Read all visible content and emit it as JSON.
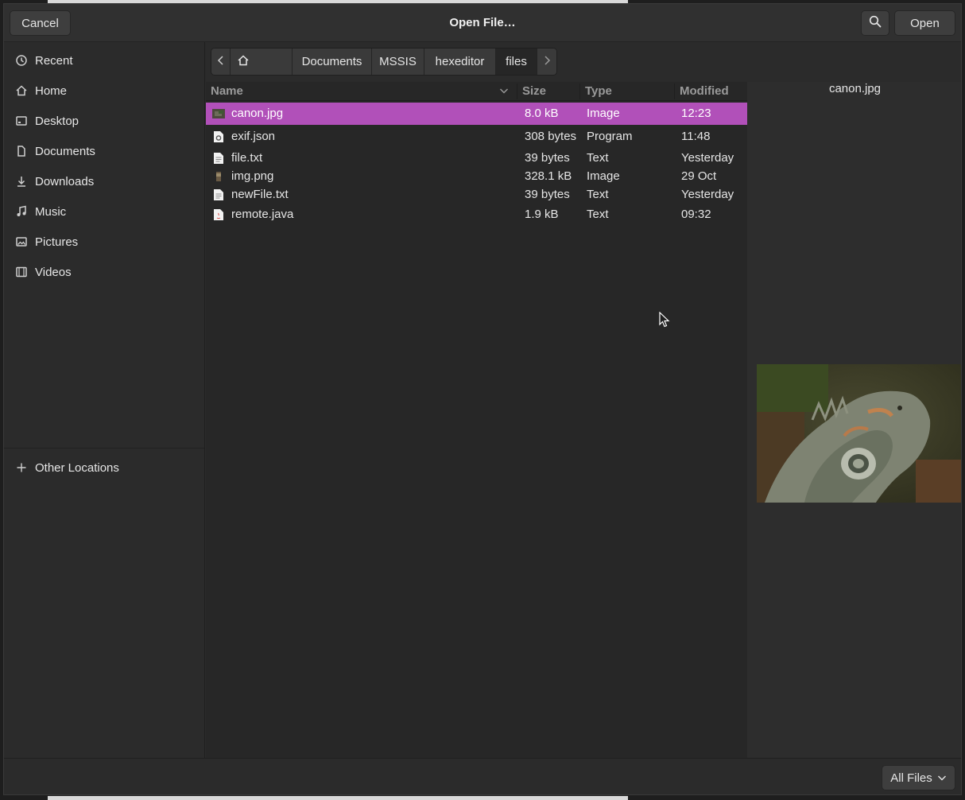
{
  "window": {
    "title": "Open File…"
  },
  "header": {
    "cancel_label": "Cancel",
    "open_label": "Open",
    "search_icon": "search-icon"
  },
  "sidebar": {
    "items": [
      {
        "label": "Recent",
        "icon": "recent-icon"
      },
      {
        "label": "Home",
        "icon": "home-icon"
      },
      {
        "label": "Desktop",
        "icon": "desktop-icon"
      },
      {
        "label": "Documents",
        "icon": "documents-icon"
      },
      {
        "label": "Downloads",
        "icon": "downloads-icon"
      },
      {
        "label": "Music",
        "icon": "music-icon"
      },
      {
        "label": "Pictures",
        "icon": "pictures-icon"
      },
      {
        "label": "Videos",
        "icon": "videos-icon"
      }
    ],
    "other_locations": "Other Locations"
  },
  "pathbar": {
    "crumbs": [
      "Documents",
      "MSSIS",
      "hexeditor",
      "files"
    ],
    "active": "files"
  },
  "filelist": {
    "columns": {
      "name": "Name",
      "size": "Size",
      "type": "Type",
      "modified": "Modified"
    },
    "rows": [
      {
        "name": "canon.jpg",
        "size": "8.0 kB",
        "type": "Image",
        "modified": "12:23",
        "icon": "image-thumbnail-icon",
        "selected": true
      },
      {
        "name": "exif.json",
        "size": "308 bytes",
        "type": "Program",
        "modified": "11:48",
        "icon": "program-file-icon",
        "selected": false
      },
      {
        "name": "file.txt",
        "size": "39 bytes",
        "type": "Text",
        "modified": "Yesterday",
        "icon": "text-file-icon",
        "selected": false
      },
      {
        "name": "img.png",
        "size": "328.1 kB",
        "type": "Image",
        "modified": "29 Oct",
        "icon": "image-thumbnail-icon",
        "selected": false
      },
      {
        "name": "newFile.txt",
        "size": "39 bytes",
        "type": "Text",
        "modified": "Yesterday",
        "icon": "text-file-icon",
        "selected": false
      },
      {
        "name": "remote.java",
        "size": "1.9 kB",
        "type": "Text",
        "modified": "09:32",
        "icon": "java-file-icon",
        "selected": false
      }
    ]
  },
  "preview": {
    "filename": "canon.jpg",
    "image": "iguana-photo"
  },
  "footer": {
    "filter_label": "All Files"
  },
  "colors": {
    "selection": "#b150b9",
    "dialog_bg": "#2b2b2b",
    "list_bg": "#272727"
  }
}
